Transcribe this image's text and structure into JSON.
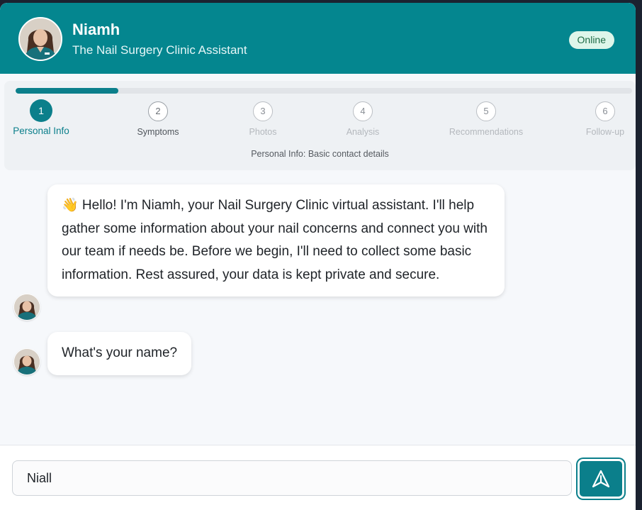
{
  "header": {
    "name": "Niamh",
    "subtitle": "The Nail Surgery Clinic Assistant",
    "status": "Online"
  },
  "progress": {
    "value": 0.167,
    "steps": [
      {
        "number": "1",
        "label": "Personal Info",
        "state": "active"
      },
      {
        "number": "2",
        "label": "Symptoms",
        "state": "next"
      },
      {
        "number": "3",
        "label": "Photos",
        "state": "pending"
      },
      {
        "number": "4",
        "label": "Analysis",
        "state": "pending"
      },
      {
        "number": "5",
        "label": "Recommendations",
        "state": "pending"
      },
      {
        "number": "6",
        "label": "Follow-up",
        "state": "pending"
      }
    ],
    "description": "Personal Info: Basic contact details"
  },
  "messages": [
    {
      "sender": "assistant",
      "text": "👋 Hello! I'm Niamh, your Nail Surgery Clinic virtual assistant. I'll help gather some information about your nail concerns and connect you with our team if needs be. Before we begin, I'll need to collect some basic information. Rest assured, your data is kept private and secure."
    },
    {
      "sender": "assistant",
      "text": "What's your name?"
    }
  ],
  "composer": {
    "value": "Niall",
    "send_icon": "send-icon"
  },
  "colors": {
    "brand": "#04868f",
    "accent": "#0b7f8b",
    "status_bg": "#def6ea",
    "status_text": "#1e6b46"
  }
}
